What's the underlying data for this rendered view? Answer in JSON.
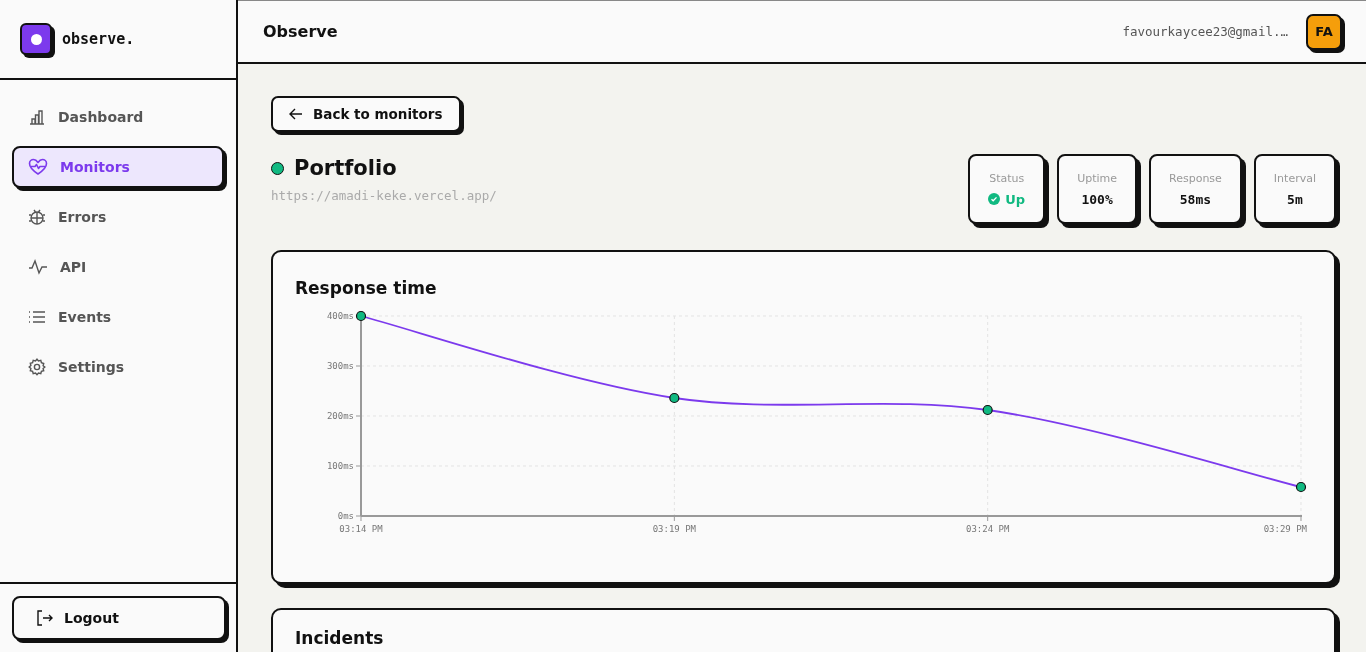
{
  "brand": {
    "name": "observe."
  },
  "sidebar": {
    "items": [
      {
        "label": "Dashboard",
        "selected": false
      },
      {
        "label": "Monitors",
        "selected": true
      },
      {
        "label": "Errors",
        "selected": false
      },
      {
        "label": "API",
        "selected": false
      },
      {
        "label": "Events",
        "selected": false
      },
      {
        "label": "Settings",
        "selected": false
      }
    ],
    "logout": "Logout"
  },
  "header": {
    "title": "Observe",
    "email": "favourkaycee23@gmail.…",
    "avatar": "FA"
  },
  "back_button": "Back to monitors",
  "monitor": {
    "name": "Portfolio",
    "url": "https://amadi-keke.vercel.app/",
    "color": "#10b981"
  },
  "stats": [
    {
      "kind": "status",
      "label": "Status",
      "value": "Up",
      "color": "#10b981"
    },
    {
      "kind": "plain",
      "label": "Uptime",
      "value": "100%"
    },
    {
      "kind": "plain",
      "label": "Response",
      "value": "58ms"
    },
    {
      "kind": "plain",
      "label": "Interval",
      "value": "5m"
    }
  ],
  "response_card": {
    "title": "Response time",
    "chart_data": {
      "type": "line",
      "categories": [
        "03:14 PM",
        "03:19 PM",
        "03:24 PM",
        "03:29 PM"
      ],
      "series": [
        {
          "color": "#7c3aed",
          "marker": "circle",
          "values": [
            400,
            236,
            212,
            58
          ]
        }
      ],
      "grid": true,
      "ylim": [
        0,
        400
      ],
      "yticks": [
        {
          "value": 0,
          "label": "0ms"
        },
        {
          "value": 100,
          "label": "100ms"
        },
        {
          "value": 200,
          "label": "200ms"
        },
        {
          "value": 300,
          "label": "300ms"
        },
        {
          "value": 400,
          "label": "400ms"
        }
      ]
    }
  },
  "incidents_card": {
    "title": "Incidents"
  }
}
